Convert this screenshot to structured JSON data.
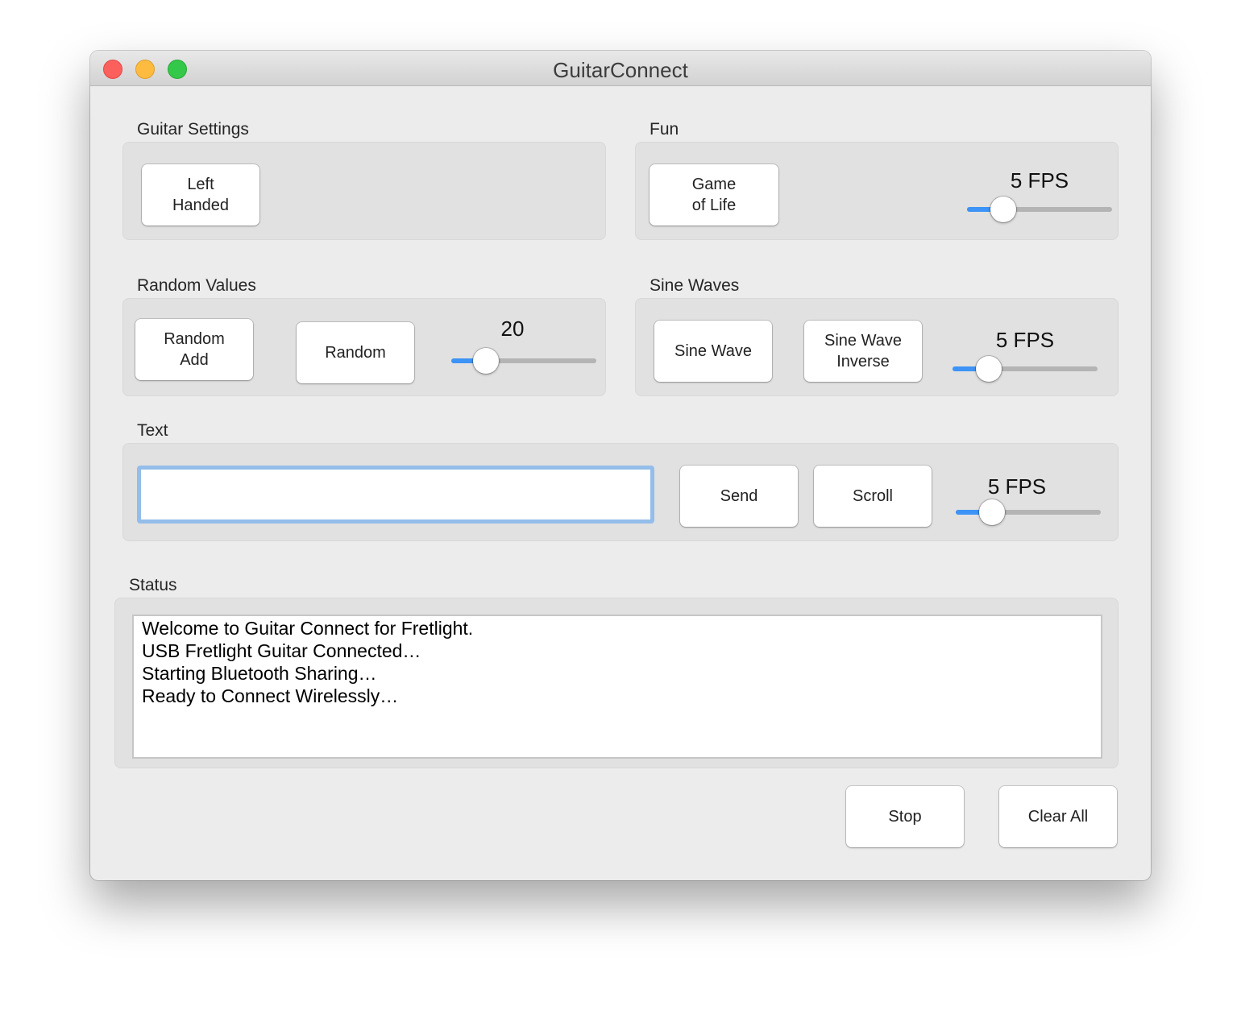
{
  "window": {
    "title": "GuitarConnect",
    "controls": [
      "close",
      "minimize",
      "maximize"
    ]
  },
  "guitar_settings": {
    "label": "Guitar Settings",
    "left_handed_button": "Left\nHanded"
  },
  "fun": {
    "label": "Fun",
    "game_of_life_button": "Game\nof Life",
    "fps_label": "5 FPS",
    "fps_slider_fraction": 0.25
  },
  "random_values": {
    "label": "Random Values",
    "random_add_button": "Random\nAdd",
    "random_button": "Random",
    "value_label": "20",
    "value_slider_fraction": 0.24
  },
  "sine_waves": {
    "label": "Sine Waves",
    "sine_wave_button": "Sine Wave",
    "sine_wave_inverse_button": "Sine Wave\nInverse",
    "fps_label": "5 FPS",
    "fps_slider_fraction": 0.25
  },
  "text": {
    "label": "Text",
    "input_value": "",
    "input_placeholder": "",
    "send_button": "Send",
    "scroll_button": "Scroll",
    "fps_label": "5 FPS",
    "fps_slider_fraction": 0.25
  },
  "status": {
    "label": "Status",
    "lines": [
      "Welcome to Guitar Connect for Fretlight.",
      "USB Fretlight Guitar Connected…",
      "Starting Bluetooth Sharing…",
      "Ready to Connect Wirelessly…"
    ]
  },
  "footer": {
    "stop_button": "Stop",
    "clear_all_button": "Clear All"
  },
  "colors": {
    "accent": "#3d93f6",
    "focus_ring": "#94bde9",
    "close": "#fc605c",
    "minimize": "#fdbc40",
    "maximize": "#34c84a"
  }
}
